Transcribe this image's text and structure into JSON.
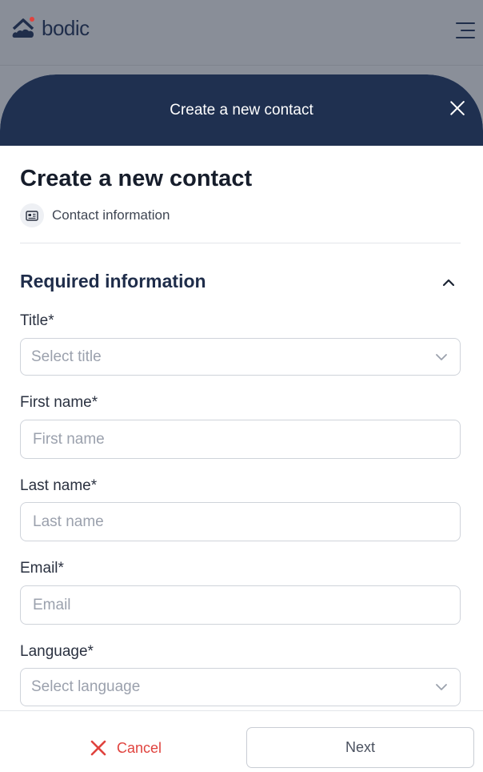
{
  "app": {
    "logo_text": "bodic"
  },
  "modal": {
    "header_title": "Create a new contact"
  },
  "form": {
    "title": "Create a new contact",
    "step_label": "Contact information",
    "section_title": "Required information",
    "fields": {
      "title": {
        "label": "Title*",
        "placeholder": "Select title"
      },
      "first_name": {
        "label": "First name*",
        "placeholder": "First name"
      },
      "last_name": {
        "label": "Last name*",
        "placeholder": "Last name"
      },
      "email": {
        "label": "Email*",
        "placeholder": "Email"
      },
      "language": {
        "label": "Language*",
        "placeholder": "Select language"
      }
    }
  },
  "footer": {
    "cancel_label": "Cancel",
    "next_label": "Next"
  },
  "icons": {
    "logo": "bodic-logo-icon",
    "menu": "hamburger-menu-icon",
    "close": "close-icon",
    "step": "contact-card-icon",
    "collapse": "chevron-up-icon",
    "dropdown": "chevron-down-icon",
    "cancel": "close-icon"
  },
  "colors": {
    "brand_navy": "#1f3050",
    "accent_red": "#e0433e",
    "overlay_gray": "#898e98"
  }
}
